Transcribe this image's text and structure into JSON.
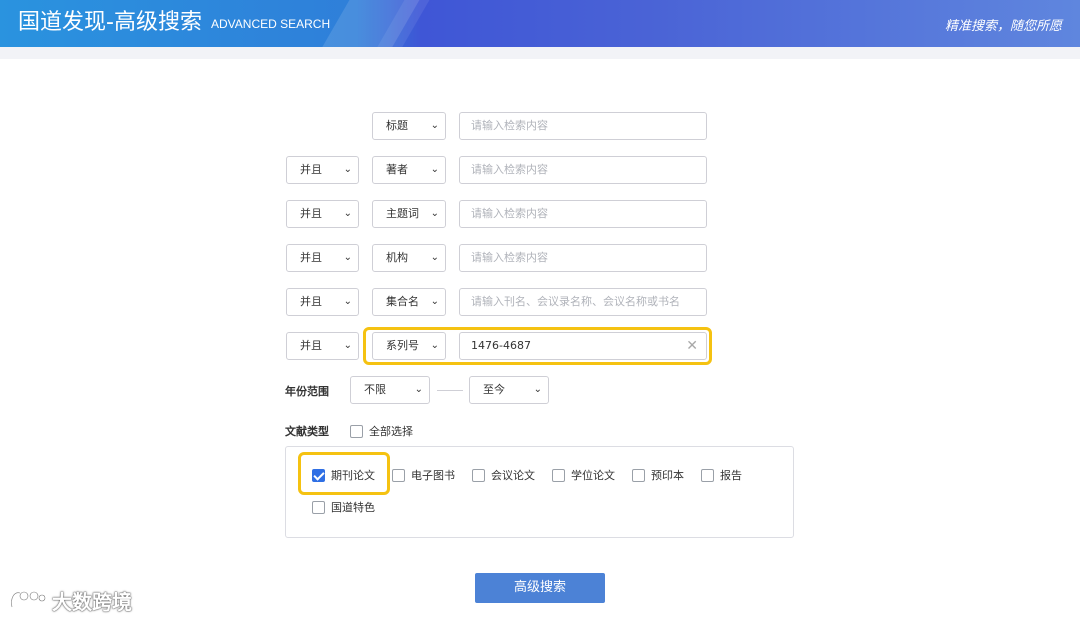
{
  "header": {
    "title": "国道发现-高级搜索",
    "subtitle": "ADVANCED SEARCH",
    "slogan": "精准搜索，随您所愿"
  },
  "search_rows": [
    {
      "logic": null,
      "field": "标题",
      "placeholder": "请输入检索内容",
      "value": ""
    },
    {
      "logic": "并且",
      "field": "著者",
      "placeholder": "请输入检索内容",
      "value": ""
    },
    {
      "logic": "并且",
      "field": "主题词",
      "placeholder": "请输入检索内容",
      "value": ""
    },
    {
      "logic": "并且",
      "field": "机构",
      "placeholder": "请输入检索内容",
      "value": ""
    },
    {
      "logic": "并且",
      "field": "集合名",
      "placeholder": "请输入刊名、会议录名称、会议名称或书名",
      "value": ""
    },
    {
      "logic": "并且",
      "field": "系列号",
      "placeholder": "",
      "value": "1476-4687"
    }
  ],
  "year_range": {
    "label": "年份范围",
    "from": "不限",
    "to": "至今"
  },
  "doc_types": {
    "label": "文献类型",
    "select_all": "全部选择",
    "options": [
      {
        "label": "期刊论文",
        "checked": true
      },
      {
        "label": "电子图书",
        "checked": false
      },
      {
        "label": "会议论文",
        "checked": false
      },
      {
        "label": "学位论文",
        "checked": false
      },
      {
        "label": "预印本",
        "checked": false
      },
      {
        "label": "报告",
        "checked": false
      },
      {
        "label": "国道特色",
        "checked": false
      }
    ]
  },
  "submit_label": "高级搜索",
  "watermark": "大数跨境",
  "colors": {
    "highlight": "#f5c211",
    "accent": "#2f6fe4",
    "button": "#4c82d6"
  }
}
